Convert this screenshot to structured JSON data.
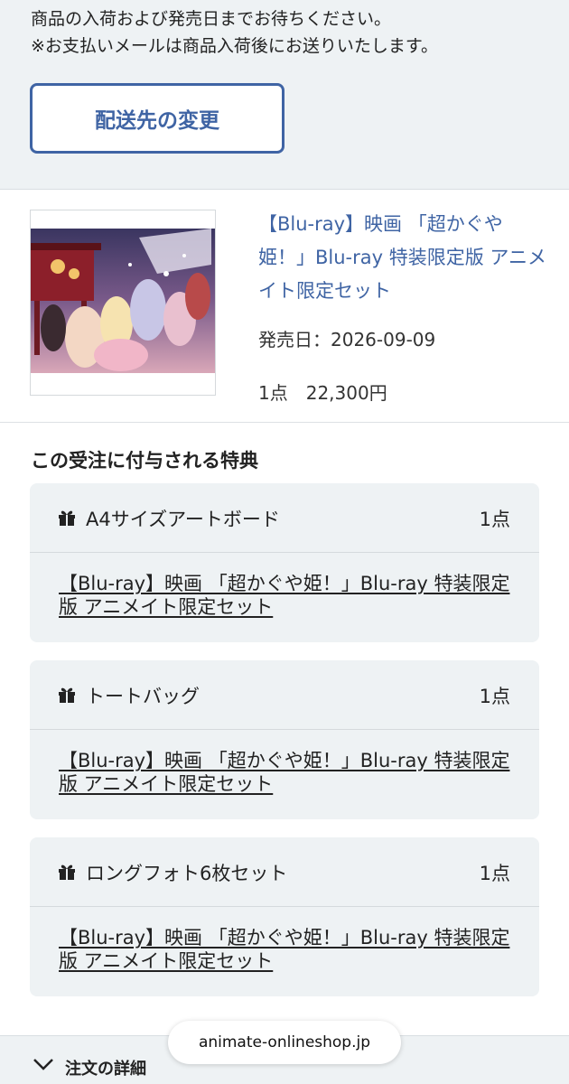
{
  "notice": {
    "line1": "商品の入荷および発売日までお待ちください。",
    "line2": "※お支払いメールは商品入荷後にお送りいたします。",
    "change_button": "配送先の変更"
  },
  "product": {
    "title": "【Blu-ray】映画 「超かぐや姫！」Blu-ray 特装限定版 アニメイト限定セット",
    "release": "発売日：2026-09-09",
    "qty_price": "1点　22,300円"
  },
  "bonus": {
    "heading": "この受注に付与される特典",
    "items": [
      {
        "name": "A4サイズアートボード",
        "qty": "1点",
        "link": "【Blu-ray】映画 「超かぐや姫！」Blu-ray 特装限定版 アニメイト限定セット"
      },
      {
        "name": "トートバッグ",
        "qty": "1点",
        "link": "【Blu-ray】映画 「超かぐや姫！」Blu-ray 特装限定版 アニメイト限定セット"
      },
      {
        "name": "ロングフォト6枚セット",
        "qty": "1点",
        "link": "【Blu-ray】映画 「超かぐや姫！」Blu-ray 特装限定版 アニメイト限定セット"
      }
    ]
  },
  "footer": {
    "details_label": "注文の詳細"
  },
  "browser": {
    "url": "animate-onlineshop.jp"
  },
  "colors": {
    "accent": "#3f64a4",
    "panel": "#eef2f4"
  },
  "icons": {
    "gift": "gift-icon",
    "chevron": "chevron-down-icon"
  }
}
